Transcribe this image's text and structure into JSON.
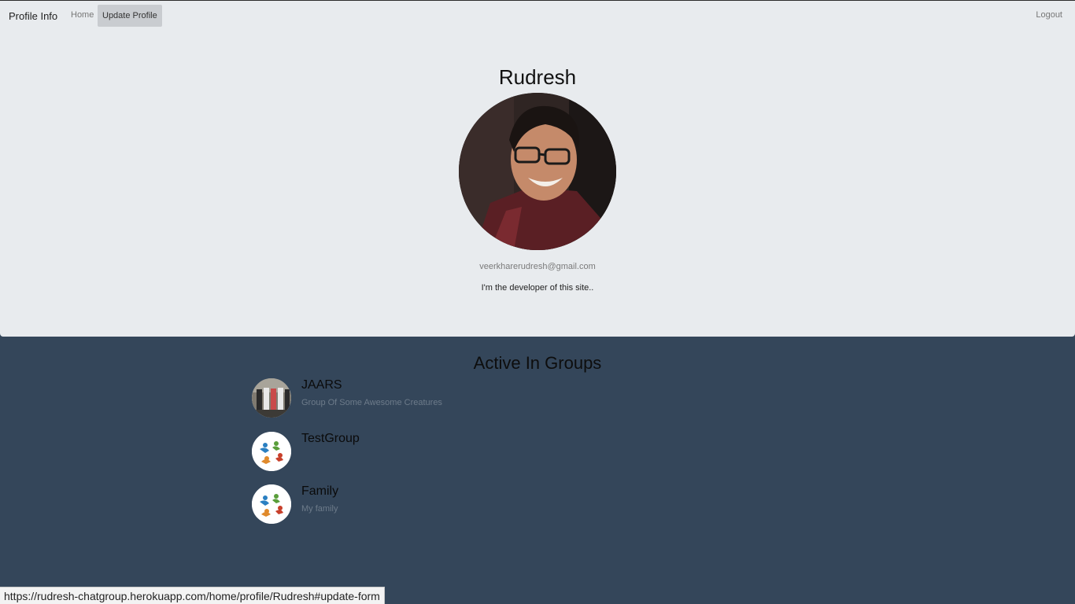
{
  "navbar": {
    "brand": "Profile Info",
    "home": "Home",
    "update_profile": "Update Profile",
    "logout": "Logout"
  },
  "profile": {
    "name": "Rudresh",
    "email": "veerkharerudresh@gmail.com",
    "bio": "I'm the developer of this site.."
  },
  "groups": {
    "title": "Active In Groups",
    "items": [
      {
        "name": "JAARS",
        "description": "Group Of Some Awesome Creatures"
      },
      {
        "name": "TestGroup",
        "description": ""
      },
      {
        "name": "Family",
        "description": "My family"
      }
    ]
  },
  "status_bar": {
    "url": "https://rudresh-chatgroup.herokuapp.com/home/profile/Rudresh#update-form"
  },
  "colors": {
    "panel_background": "#e8ebee",
    "page_background": "#34465a"
  }
}
